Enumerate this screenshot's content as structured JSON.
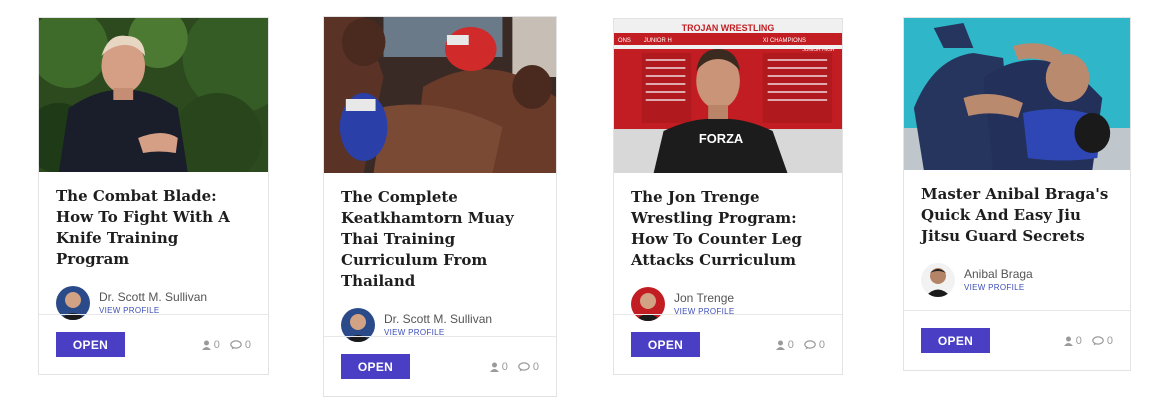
{
  "cards": [
    {
      "title": "The Combat Blade: How To Fight With A Knife Training Program",
      "author": "Dr. Scott M. Sullivan",
      "view_profile": "VIEW PROFILE",
      "open_label": "OPEN",
      "users_count": "0",
      "comments_count": "0"
    },
    {
      "title": "The Complete Keatkhamtorn Muay Thai Training Curriculum From Thailand",
      "author": "Dr. Scott M. Sullivan",
      "view_profile": "VIEW PROFILE",
      "open_label": "OPEN",
      "users_count": "0",
      "comments_count": "0"
    },
    {
      "title": "The Jon Trenge Wrestling Program: How To Counter Leg Attacks Curriculum",
      "author": "Jon Trenge",
      "view_profile": "VIEW PROFILE",
      "open_label": "OPEN",
      "users_count": "0",
      "comments_count": "0",
      "thumb_text": {
        "banner": "TROJAN WRESTLING",
        "banner_left": "ONS",
        "banner_mid": "JUNIOR H",
        "banner_right": "XI CHAMPIONS",
        "banner_right2": "JUNIOR HIGH",
        "shirt": "FORZA"
      }
    },
    {
      "title": "Master Anibal Braga's Quick And Easy Jiu Jitsu Guard Secrets",
      "author": "Anibal Braga",
      "view_profile": "VIEW PROFILE",
      "open_label": "OPEN",
      "users_count": "0",
      "comments_count": "0"
    }
  ],
  "colors": {
    "accent": "#4a3fc4",
    "link": "#3d4fb8",
    "border": "#e3e3e3"
  },
  "icons": {
    "users": "user-icon",
    "comments": "comment-icon"
  }
}
